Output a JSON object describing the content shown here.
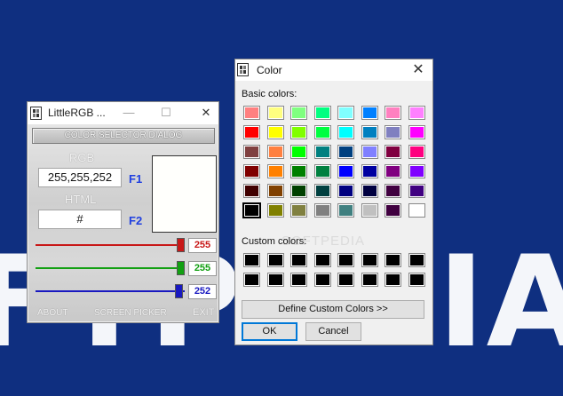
{
  "background": {
    "text": "FTPEDIA",
    "color": "#0f2f80"
  },
  "littlergb": {
    "title": "LittleRGB ...",
    "minimize_glyph": "—",
    "maximize_glyph": "☐",
    "close_glyph": "✕",
    "selector_button": "COLOR SELECTOR DIALOG",
    "rgb_label": "RGB",
    "rgb_value": "255,255,252",
    "rgb_hotkey": "F1",
    "html_label": "HTML",
    "html_value": "#",
    "html_hotkey": "F2",
    "preview_color": "#fffffc",
    "sliders": [
      {
        "name": "red",
        "value": "255",
        "fraction": 1.0,
        "color": "#c81818"
      },
      {
        "name": "green",
        "value": "255",
        "fraction": 1.0,
        "color": "#12a012"
      },
      {
        "name": "blue",
        "value": "252",
        "fraction": 0.988,
        "color": "#1818c0"
      }
    ],
    "about": "ABOUT",
    "screen_picker": "SCREEN PICKER",
    "exit": "EXIT"
  },
  "color_dialog": {
    "title": "Color",
    "close_glyph": "✕",
    "basic_label": "Basic colors:",
    "custom_label": "Custom colors:",
    "basic_colors": [
      [
        "#ff8080",
        "#ffff80",
        "#80ff80",
        "#00ff80",
        "#80ffff",
        "#0080ff",
        "#ff80c0",
        "#ff80ff"
      ],
      [
        "#ff0000",
        "#ffff00",
        "#80ff00",
        "#00ff40",
        "#00ffff",
        "#0080c0",
        "#8080c0",
        "#ff00ff"
      ],
      [
        "#804040",
        "#ff8040",
        "#00ff00",
        "#008080",
        "#004080",
        "#8080ff",
        "#800040",
        "#ff0080"
      ],
      [
        "#800000",
        "#ff8000",
        "#008000",
        "#008040",
        "#0000ff",
        "#0000a0",
        "#800080",
        "#8000ff"
      ],
      [
        "#400000",
        "#804000",
        "#004000",
        "#004040",
        "#000080",
        "#000040",
        "#400040",
        "#400080"
      ],
      [
        "#000000",
        "#808000",
        "#808040",
        "#808080",
        "#408080",
        "#c0c0c0",
        "#400040",
        "#ffffff"
      ]
    ],
    "custom_colors": [
      [
        "#000000",
        "#000000",
        "#000000",
        "#000000",
        "#000000",
        "#000000",
        "#000000",
        "#000000"
      ],
      [
        "#000000",
        "#000000",
        "#000000",
        "#000000",
        "#000000",
        "#000000",
        "#000000",
        "#000000"
      ]
    ],
    "define_button": "Define Custom Colors >>",
    "ok_button": "OK",
    "cancel_button": "Cancel",
    "watermark": "SOFTPEDIA"
  }
}
